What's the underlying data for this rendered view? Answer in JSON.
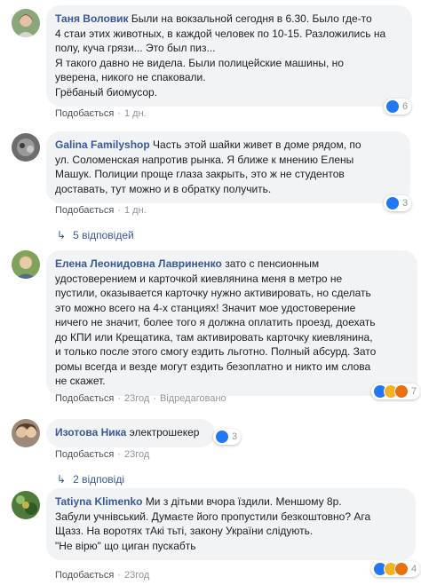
{
  "comments": [
    {
      "author": "Таня Воловик",
      "text": "Были на вокзальной сегодня в 6.30. Было где-то\n4 стаи этих животных, в каждой человек по 10-15. Разложились на полу, куча грязи... Это был пиз...\nЯ такого давно не видела. Были полицейские машины, но\nуверена, никого не спаковали.\nГрёбаный биомусор.",
      "like_label": "Подобається",
      "time": "1 дн.",
      "reaction_count": "6",
      "reactions": [
        "like-icon"
      ]
    },
    {
      "author": "Galina Familyshop",
      "text": "Часть этой шайки живет в доме рядом, по\nул. Соломенская напротив рынка. Я ближе к мнению Елены\nМашук. Полиции проще глаза закрыть, это ж не студентов\nдоставать, тут можно и в обратку получить.",
      "like_label": "Подобається",
      "time": "1 дн.",
      "reaction_count": "3",
      "reactions": [
        "like-icon"
      ],
      "replies": "5 відповідей"
    },
    {
      "author": "Елена Леонидовна Лавриненко",
      "text": "зато с пенсионным\nудостоверением и карточкой киевлянина меня в метро не\nпустили, оказывается карточку нужно активировать, но сделать\nэто можно всего на 4-х станциях! Значит мое удостоверение\nничего не значит, более того я должна оплатить проезд, доехать\nдо КПИ или Крещатика, там активировать карточку киевлянина,\nи только после этого смогу ездить льготно. Полный абсурд. Зато\nромы всегда и везде могут ездить безоплатно и никто им слова\nне скажет.",
      "like_label": "Подобається",
      "time": "23год",
      "edited": "Відредаговано",
      "reaction_count": "7",
      "reactions": [
        "like-icon",
        "haha-icon",
        "angry-icon"
      ]
    },
    {
      "author": "Изотова Ника",
      "text": "электрошекер",
      "like_label": "Подобається",
      "time": "23год",
      "reaction_count": "3",
      "reactions": [
        "like-icon"
      ],
      "replies": "2 відповіді"
    },
    {
      "author": "Tatiyna Klimenko",
      "text": "Ми з дітьми вчора їздили. Меншому 8р.\nЗабули учнівський. Думаєте його пропустили безкоштовно? Ага\nЩазз. На воротях тАкі тьті, закону України слідують.\n\"Не вірю\" що циган пускабть",
      "like_label": "Подобається",
      "time": "23год",
      "reaction_count": "4",
      "reactions": [
        "like-icon",
        "haha-icon",
        "angry-icon"
      ]
    }
  ],
  "separator": "·",
  "colors": {
    "author": "#385898",
    "bubble": "#f2f3f5",
    "like": "#2078f4",
    "haha": "#f7b125",
    "angry": "#e9710f",
    "meta": "#90949c"
  }
}
